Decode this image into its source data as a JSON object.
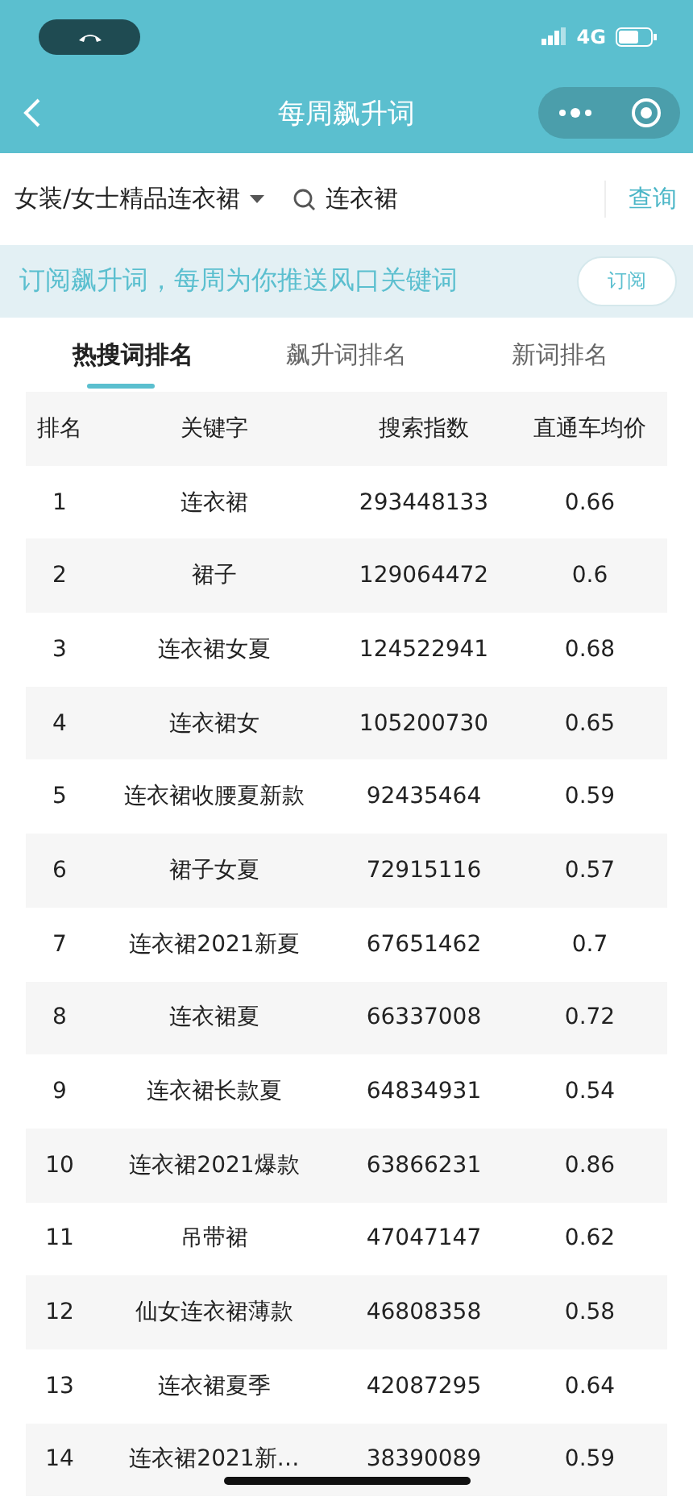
{
  "status_bar": {
    "network": "4G"
  },
  "nav": {
    "title": "每周飙升词"
  },
  "filter": {
    "category": "女装/女士精品连衣裙",
    "search_value": "连衣裙",
    "query_button": "查询"
  },
  "banner": {
    "text": "订阅飙升词，每周为你推送风口关键词",
    "button": "订阅"
  },
  "tabs": [
    {
      "label": "热搜词排名",
      "selected": true
    },
    {
      "label": "飙升词排名",
      "selected": false
    },
    {
      "label": "新词排名",
      "selected": false
    }
  ],
  "table": {
    "columns": [
      "排名",
      "关键字",
      "搜索指数",
      "直通车均价"
    ],
    "rows": [
      [
        "1",
        "连衣裙",
        "293448133",
        "0.66"
      ],
      [
        "2",
        "裙子",
        "129064472",
        "0.6"
      ],
      [
        "3",
        "连衣裙女夏",
        "124522941",
        "0.68"
      ],
      [
        "4",
        "连衣裙女",
        "105200730",
        "0.65"
      ],
      [
        "5",
        "连衣裙收腰夏新款",
        "92435464",
        "0.59"
      ],
      [
        "6",
        "裙子女夏",
        "72915116",
        "0.57"
      ],
      [
        "7",
        "连衣裙2021新夏",
        "67651462",
        "0.7"
      ],
      [
        "8",
        "连衣裙夏",
        "66337008",
        "0.72"
      ],
      [
        "9",
        "连衣裙长款夏",
        "64834931",
        "0.54"
      ],
      [
        "10",
        "连衣裙2021爆款",
        "63866231",
        "0.86"
      ],
      [
        "11",
        "吊带裙",
        "47047147",
        "0.62"
      ],
      [
        "12",
        "仙女连衣裙薄款",
        "46808358",
        "0.58"
      ],
      [
        "13",
        "连衣裙夏季",
        "42087295",
        "0.64"
      ],
      [
        "14",
        "连衣裙2021新…",
        "38390089",
        "0.59"
      ]
    ]
  }
}
